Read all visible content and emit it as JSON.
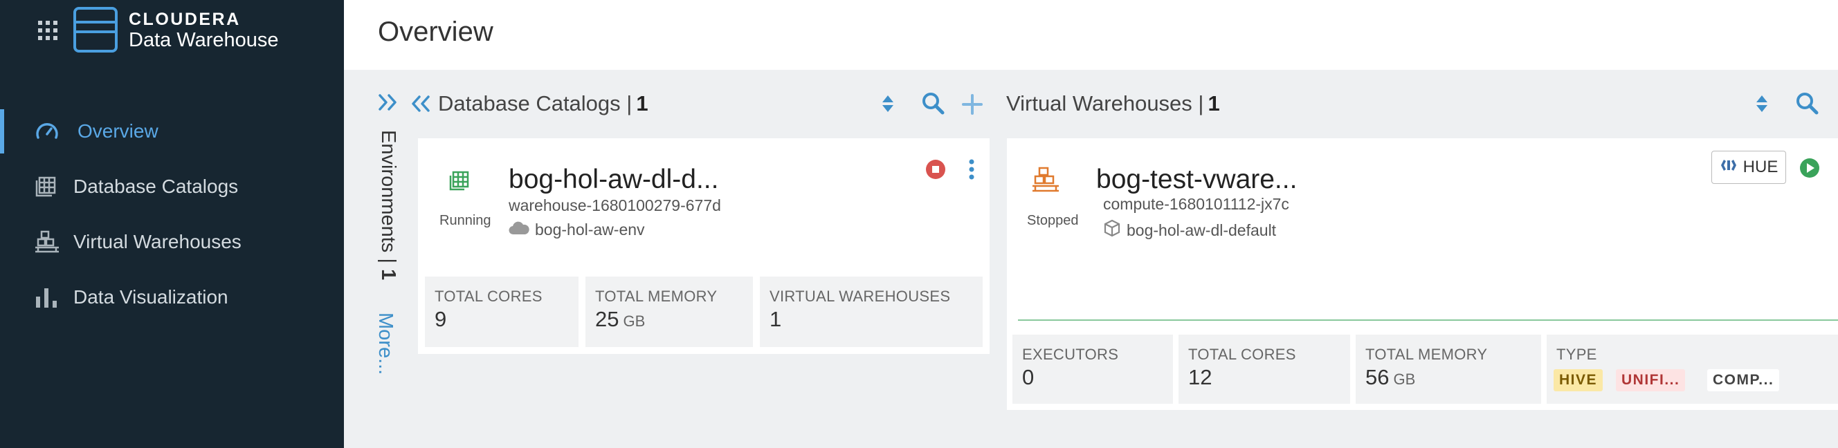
{
  "brand": {
    "name": "CLOUDERA",
    "product": "Data Warehouse"
  },
  "nav": [
    {
      "label": "Overview",
      "icon": "gauge-icon",
      "active": true
    },
    {
      "label": "Database Catalogs",
      "icon": "catalog-icon"
    },
    {
      "label": "Virtual Warehouses",
      "icon": "warehouse-icon"
    },
    {
      "label": "Data Visualization",
      "icon": "bar-chart-icon"
    }
  ],
  "page": {
    "title": "Overview"
  },
  "environments": {
    "label": "Environments",
    "count": "1",
    "more": "More..."
  },
  "catalogs": {
    "heading": "Database Catalogs",
    "count": "1",
    "card": {
      "status": "Running",
      "title": "bog-hol-aw-dl-d...",
      "id": "warehouse-1680100279-677d",
      "env": "bog-hol-aw-env",
      "metrics": [
        {
          "label": "TOTAL CORES",
          "value": "9",
          "unit": ""
        },
        {
          "label": "TOTAL MEMORY",
          "value": "25",
          "unit": "GB"
        },
        {
          "label": "VIRTUAL WAREHOUSES",
          "value": "1",
          "unit": ""
        }
      ]
    }
  },
  "warehouses": {
    "heading": "Virtual Warehouses",
    "count": "1",
    "card": {
      "status": "Stopped",
      "title": "bog-test-vware...",
      "id": "compute-1680101112-jx7c",
      "catalog": "bog-hol-aw-dl-default",
      "hue_label": "HUE",
      "metrics": [
        {
          "label": "EXECUTORS",
          "value": "0",
          "unit": ""
        },
        {
          "label": "TOTAL CORES",
          "value": "12",
          "unit": ""
        },
        {
          "label": "TOTAL MEMORY",
          "value": "56",
          "unit": "GB"
        }
      ],
      "type_label": "TYPE",
      "tags": [
        "HIVE",
        "UNIFI...",
        "COMP..."
      ]
    }
  },
  "colors": {
    "sidebar": "#172631",
    "accent": "#5aa8e6",
    "running": "#3aa35a",
    "stopped": "#e07a2e",
    "stop_button": "#d9534f"
  }
}
